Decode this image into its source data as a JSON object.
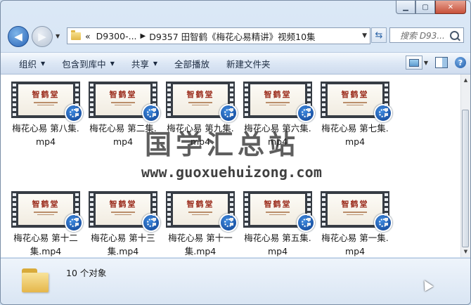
{
  "window": {
    "controls": {
      "minimize": "▁",
      "maximize": "▢",
      "close": "✕"
    }
  },
  "address": {
    "overflow": "«",
    "crumbs": [
      "D9300-...",
      "D9357 田智鹤《梅花心易精讲》视频10集"
    ],
    "search_placeholder": "搜索 D93..."
  },
  "toolbar": {
    "organize": "组织",
    "include_library": "包含到库中",
    "share": "共享",
    "play_all": "全部播放",
    "new_folder": "新建文件夹"
  },
  "thumbnail": {
    "logo": "智鹤堂"
  },
  "files": [
    {
      "line1": "梅花心易 第八集.",
      "line2": "mp4"
    },
    {
      "line1": "梅花心易 第二集.",
      "line2": "mp4"
    },
    {
      "line1": "梅花心易 第九集.",
      "line2": "mp4"
    },
    {
      "line1": "梅花心易 第六集.",
      "line2": "mp4"
    },
    {
      "line1": "梅花心易 第七集.",
      "line2": "mp4"
    },
    {
      "line1": "梅花心易 第十二",
      "line2": "集.mp4"
    },
    {
      "line1": "梅花心易 第十三",
      "line2": "集.mp4"
    },
    {
      "line1": "梅花心易 第十一",
      "line2": "集.mp4"
    },
    {
      "line1": "梅花心易 第五集.",
      "line2": "mp4"
    },
    {
      "line1": "梅花心易 第一集.",
      "line2": "mp4"
    }
  ],
  "watermark": {
    "text": "国学汇总站",
    "url": "www.guoxuehuizong.com"
  },
  "details": {
    "count": "10 个对象"
  }
}
